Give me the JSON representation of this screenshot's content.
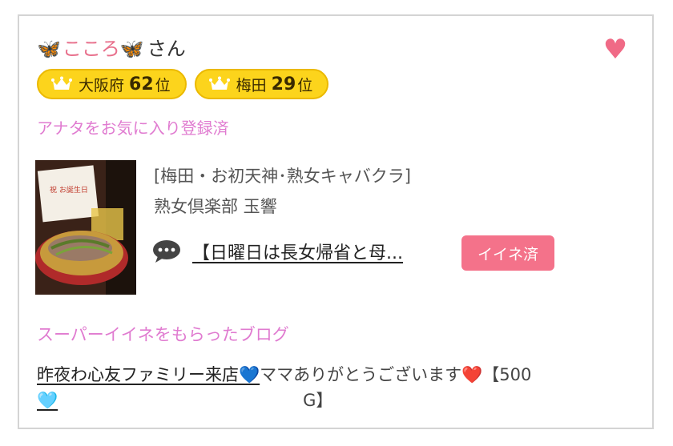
{
  "profile": {
    "butterfly_left": "🦋",
    "name": "こころ",
    "butterfly_right": "🦋",
    "honorific": "さん",
    "favorite_heart_icon": "heart-icon",
    "favorite_heart": "♥"
  },
  "rankings": [
    {
      "area": "大阪府",
      "rank": "62",
      "unit": "位"
    },
    {
      "area": "梅田",
      "rank": "29",
      "unit": "位"
    }
  ],
  "favorite_status": "アナタをお気に入り登録済",
  "shop": {
    "genre": "[梅田・お初天神･熟女キャバクラ]",
    "name": "熟女倶楽部 玉響",
    "photo_icon": "shop-photo"
  },
  "post": {
    "title": "【日曜日は長女帰省と母...",
    "iine_label": "イイネ済"
  },
  "super_iine": {
    "heading": "スーパーイイネをもらったブログ",
    "blog_link_text": "昨夜わ心友ファミリー来店💙",
    "blog_rest_text": "ママありがとうございます❤️【500",
    "blog_line2_link": "🩵",
    "blog_line2_rest": "G】"
  },
  "colors": {
    "accent_pink": "#e8708c",
    "heading_pink": "#e07bd0",
    "badge_gold": "#fcd41c",
    "iine_button": "#f4728a"
  }
}
